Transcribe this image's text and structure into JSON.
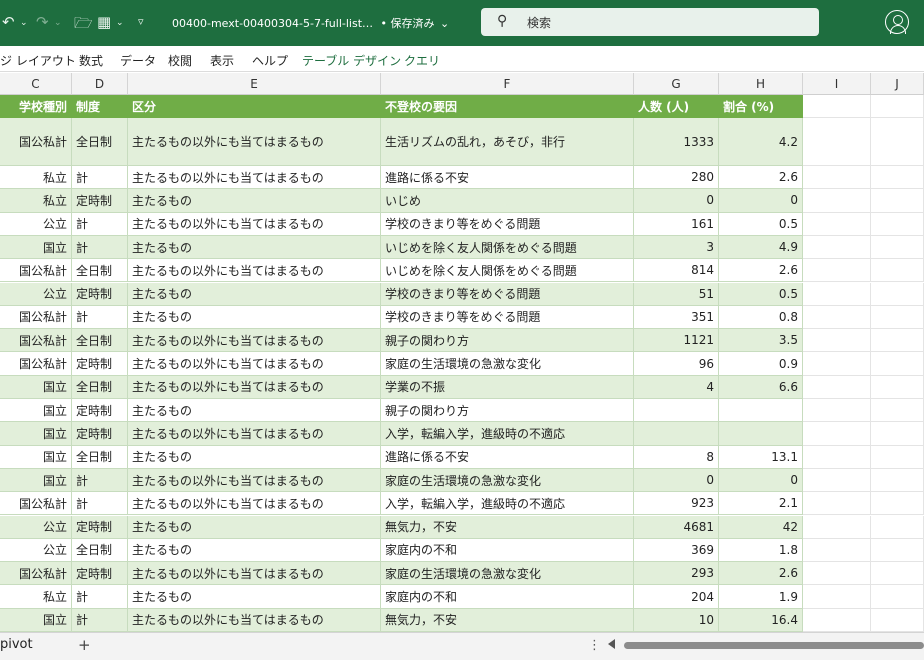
{
  "titlebar": {
    "undo_icon": "undo-icon",
    "redo_icon": "redo-icon",
    "doc_title": "00400-mext-00400304-5-7-full-list…",
    "save_status": "• 保存済み",
    "search_placeholder": "検索",
    "accent": "#1e6e3f"
  },
  "ribbon": {
    "tabs": [
      "ジ レイアウト",
      "数式",
      "データ",
      "校閲",
      "表示",
      "ヘルプ"
    ],
    "context_tabs": [
      "テーブル デザイン",
      "クエリ"
    ]
  },
  "columns": [
    "C",
    "D",
    "E",
    "F",
    "G",
    "H",
    "I",
    "J"
  ],
  "table": {
    "headers": [
      "学校種別",
      "制度",
      "区分",
      "不登校の要因",
      "人数 (人)",
      "割合 (%)"
    ],
    "rows": [
      [
        "国公私計",
        "全日制",
        "主たるもの以外にも当てはまるもの",
        "生活リズムの乱れ，あそび，非行",
        "1333",
        "4.2"
      ],
      [
        "私立",
        "計",
        "主たるもの以外にも当てはまるもの",
        "進路に係る不安",
        "280",
        "2.6"
      ],
      [
        "私立",
        "定時制",
        "主たるもの",
        "いじめ",
        "0",
        "0"
      ],
      [
        "公立",
        "計",
        "主たるもの以外にも当てはまるもの",
        "学校のきまり等をめぐる問題",
        "161",
        "0.5"
      ],
      [
        "国立",
        "計",
        "主たるもの",
        "いじめを除く友人関係をめぐる問題",
        "3",
        "4.9"
      ],
      [
        "国公私計",
        "全日制",
        "主たるもの以外にも当てはまるもの",
        "いじめを除く友人関係をめぐる問題",
        "814",
        "2.6"
      ],
      [
        "公立",
        "定時制",
        "主たるもの",
        "学校のきまり等をめぐる問題",
        "51",
        "0.5"
      ],
      [
        "国公私計",
        "計",
        "主たるもの",
        "学校のきまり等をめぐる問題",
        "351",
        "0.8"
      ],
      [
        "国公私計",
        "全日制",
        "主たるもの以外にも当てはまるもの",
        "親子の関わり方",
        "1121",
        "3.5"
      ],
      [
        "国公私計",
        "定時制",
        "主たるもの以外にも当てはまるもの",
        "家庭の生活環境の急激な変化",
        "96",
        "0.9"
      ],
      [
        "国立",
        "全日制",
        "主たるもの以外にも当てはまるもの",
        "学業の不振",
        "4",
        "6.6"
      ],
      [
        "国立",
        "定時制",
        "主たるもの",
        "親子の関わり方",
        "",
        ""
      ],
      [
        "国立",
        "定時制",
        "主たるもの以外にも当てはまるもの",
        "入学，転編入学，進級時の不適応",
        "",
        ""
      ],
      [
        "国立",
        "全日制",
        "主たるもの",
        "進路に係る不安",
        "8",
        "13.1"
      ],
      [
        "国立",
        "計",
        "主たるもの以外にも当てはまるもの",
        "家庭の生活環境の急激な変化",
        "0",
        "0"
      ],
      [
        "国公私計",
        "計",
        "主たるもの以外にも当てはまるもの",
        "入学，転編入学，進級時の不適応",
        "923",
        "2.1"
      ],
      [
        "公立",
        "定時制",
        "主たるもの",
        "無気力，不安",
        "4681",
        "42"
      ],
      [
        "公立",
        "全日制",
        "主たるもの",
        "家庭内の不和",
        "369",
        "1.8"
      ],
      [
        "国公私計",
        "定時制",
        "主たるもの以外にも当てはまるもの",
        "家庭の生活環境の急激な変化",
        "293",
        "2.6"
      ],
      [
        "私立",
        "計",
        "主たるもの",
        "家庭内の不和",
        "204",
        "1.9"
      ],
      [
        "国立",
        "計",
        "主たるもの以外にも当てはまるもの",
        "無気力，不安",
        "10",
        "16.4"
      ]
    ]
  },
  "bottombar": {
    "sheet_tab": "pivot",
    "add_sheet": "+",
    "menu": "⋮"
  },
  "colors": {
    "header_fill": "#70ad47",
    "band_fill": "#e2efda"
  }
}
